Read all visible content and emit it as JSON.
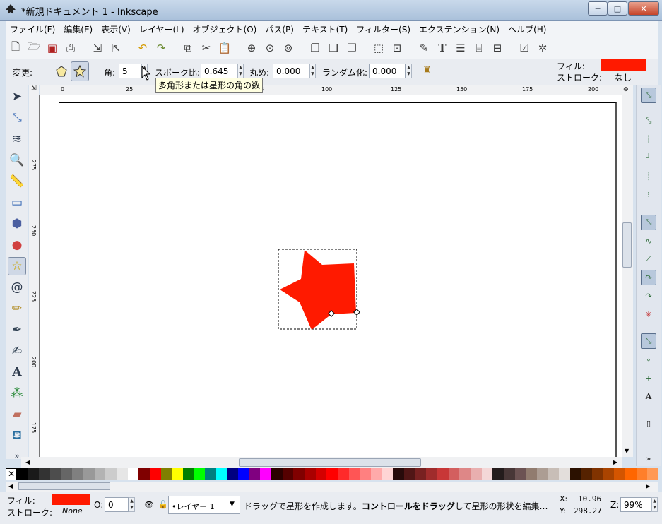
{
  "window": {
    "title": "*新規ドキュメント 1 - Inkscape",
    "minimize": "─",
    "maximize": "□",
    "close": "✕"
  },
  "menubar": [
    "ファイル(F)",
    "編集(E)",
    "表示(V)",
    "レイヤー(L)",
    "オブジェクト(O)",
    "パス(P)",
    "テキスト(T)",
    "フィルター(S)",
    "エクステンション(N)",
    "ヘルプ(H)"
  ],
  "command_icons": [
    "new-icon",
    "open-icon",
    "save-icon",
    "print-icon",
    "import-icon",
    "export-icon",
    "undo-icon",
    "redo-icon",
    "duplicate-icon",
    "cut-icon",
    "paste-icon",
    "zoom-selection-icon",
    "zoom-drawing-icon",
    "zoom-page-icon",
    "group-icon",
    "ungroup-icon",
    "clone-icon",
    "align-icon",
    "select-all-icon",
    "node-editor-icon",
    "text-icon",
    "layers-icon",
    "xml-editor-icon",
    "align-distribute-icon",
    "document-properties-icon",
    "preferences-icon"
  ],
  "controls": {
    "change_label": "変更:",
    "corners_label": "角:",
    "corners_value": "5",
    "spoke_ratio_label": "スポーク比:",
    "spoke_ratio_value": "0.645",
    "rounded_label": "丸め:",
    "rounded_value": "0.000",
    "randomized_label": "ランダム化:",
    "randomized_value": "0.000",
    "tooltip": "多角形または星形の角の数"
  },
  "style_indicator": {
    "fill_label": "フィル:",
    "stroke_label": "ストローク:",
    "stroke_value": "なし",
    "fill_color": "#ff1a00"
  },
  "rulers": {
    "horizontal": [
      "0",
      "25",
      "50",
      "75",
      "100",
      "125",
      "150",
      "175",
      "200"
    ],
    "vertical": [
      "275",
      "250",
      "225",
      "200",
      "175"
    ]
  },
  "palette": [
    "#000000",
    "#1a1a1a",
    "#333333",
    "#4d4d4d",
    "#666666",
    "#808080",
    "#999999",
    "#b3b3b3",
    "#cccccc",
    "#e6e6e6",
    "#ffffff",
    "#800000",
    "#ff0000",
    "#808000",
    "#ffff00",
    "#008000",
    "#00ff00",
    "#008080",
    "#00ffff",
    "#000080",
    "#0000ff",
    "#800080",
    "#ff00ff",
    "#2b0000",
    "#550000",
    "#800000",
    "#aa0000",
    "#d40000",
    "#ff0000",
    "#ff2a2a",
    "#ff5555",
    "#ff8080",
    "#ffaaaa",
    "#ffd5d5",
    "#280b0b",
    "#501616",
    "#782121",
    "#a02c2c",
    "#c83737",
    "#d35f5f",
    "#de8787",
    "#e9afaf",
    "#f4d7d7",
    "#241c1c",
    "#483737",
    "#6c5353",
    "#917c6f",
    "#ac9d93",
    "#c8beb7",
    "#e3dedb",
    "#2b1100",
    "#552200",
    "#803300",
    "#aa4400",
    "#d45500",
    "#ff6600",
    "#ff7f2a",
    "#ff9955"
  ],
  "status": {
    "fill_label": "フィル:",
    "stroke_label": "ストローク:",
    "stroke_value": "None",
    "fill_color": "#ff1a00",
    "opacity_label": "O:",
    "opacity_value": "0",
    "layer_value": "•レイヤー 1",
    "message_a": "ドラッグで星形を作成します。",
    "message_b": "コントロールをドラッグ",
    "message_c": "して星形の形状を編集…",
    "x_label": "X:",
    "x_value": "10.96",
    "y_label": "Y:",
    "y_value": "298.27",
    "zoom_label": "Z:",
    "zoom_value": "99%"
  }
}
